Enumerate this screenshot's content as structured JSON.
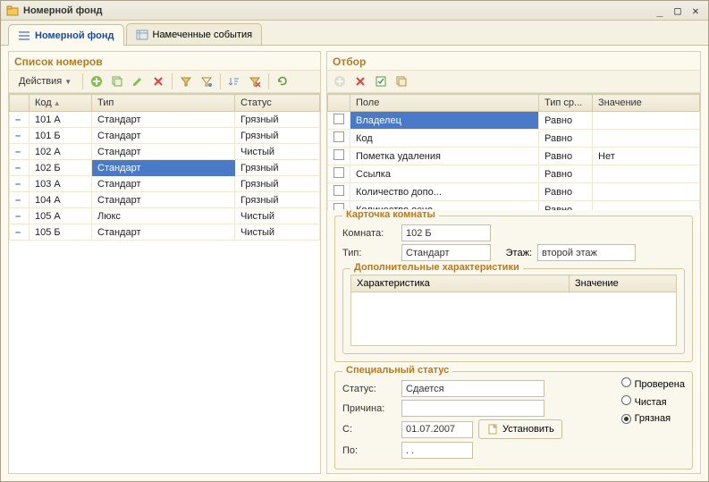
{
  "window": {
    "title": "Номерной фонд"
  },
  "tabs": [
    {
      "label": "Номерной фонд",
      "active": true
    },
    {
      "label": "Намеченные события",
      "active": false
    }
  ],
  "left": {
    "title": "Список номеров",
    "actions_label": "Действия",
    "columns": {
      "marker": "",
      "code": "Код",
      "type": "Тип",
      "status": "Статус"
    },
    "rows": [
      {
        "code": "101 А",
        "type": "Стандарт",
        "status": "Грязный"
      },
      {
        "code": "101 Б",
        "type": "Стандарт",
        "status": "Грязный"
      },
      {
        "code": "102 А",
        "type": "Стандарт",
        "status": "Чистый"
      },
      {
        "code": "102 Б",
        "type": "Стандарт",
        "status": "Грязный",
        "selected": true
      },
      {
        "code": "103 А",
        "type": "Стандарт",
        "status": "Грязный"
      },
      {
        "code": "104 А",
        "type": "Стандарт",
        "status": "Грязный"
      },
      {
        "code": "105 А",
        "type": "Люкс",
        "status": "Чистый"
      },
      {
        "code": "105 Б",
        "type": "Стандарт",
        "status": "Чистый"
      }
    ]
  },
  "right": {
    "title": "Отбор",
    "filter_columns": {
      "chk": "",
      "field": "Поле",
      "cmp": "Тип ср...",
      "value": "Значение"
    },
    "filters": [
      {
        "field": "Владелец",
        "cmp": "Равно",
        "value": "",
        "selected": true
      },
      {
        "field": "Код",
        "cmp": "Равно",
        "value": ""
      },
      {
        "field": "Пометка удаления",
        "cmp": "Равно",
        "value": "Нет"
      },
      {
        "field": "Ссылка",
        "cmp": "Равно",
        "value": ""
      },
      {
        "field": "Количество допо...",
        "cmp": "Равно",
        "value": ""
      },
      {
        "field": "Количество осно...",
        "cmp": "Равно",
        "value": ""
      }
    ],
    "card": {
      "legend": "Карточка комнаты",
      "room_label": "Комната:",
      "room": "102 Б",
      "type_label": "Тип:",
      "type": "Стандарт",
      "floor_label": "Этаж:",
      "floor": "второй этаж",
      "chars_legend": "Дополнительные характеристики",
      "chars_columns": {
        "name": "Характеристика",
        "value": "Значение"
      }
    },
    "special": {
      "legend": "Специальный статус",
      "status_label": "Статус:",
      "status": "Сдается",
      "reason_label": "Причина:",
      "reason": "",
      "from_label": "С:",
      "from": "01.07.2007",
      "to_label": "По:",
      "to": ". .",
      "set_button": "Установить",
      "radios": {
        "checked": "Проверена",
        "clean": "Чистая",
        "dirty": "Грязная",
        "selected": "dirty"
      }
    }
  }
}
